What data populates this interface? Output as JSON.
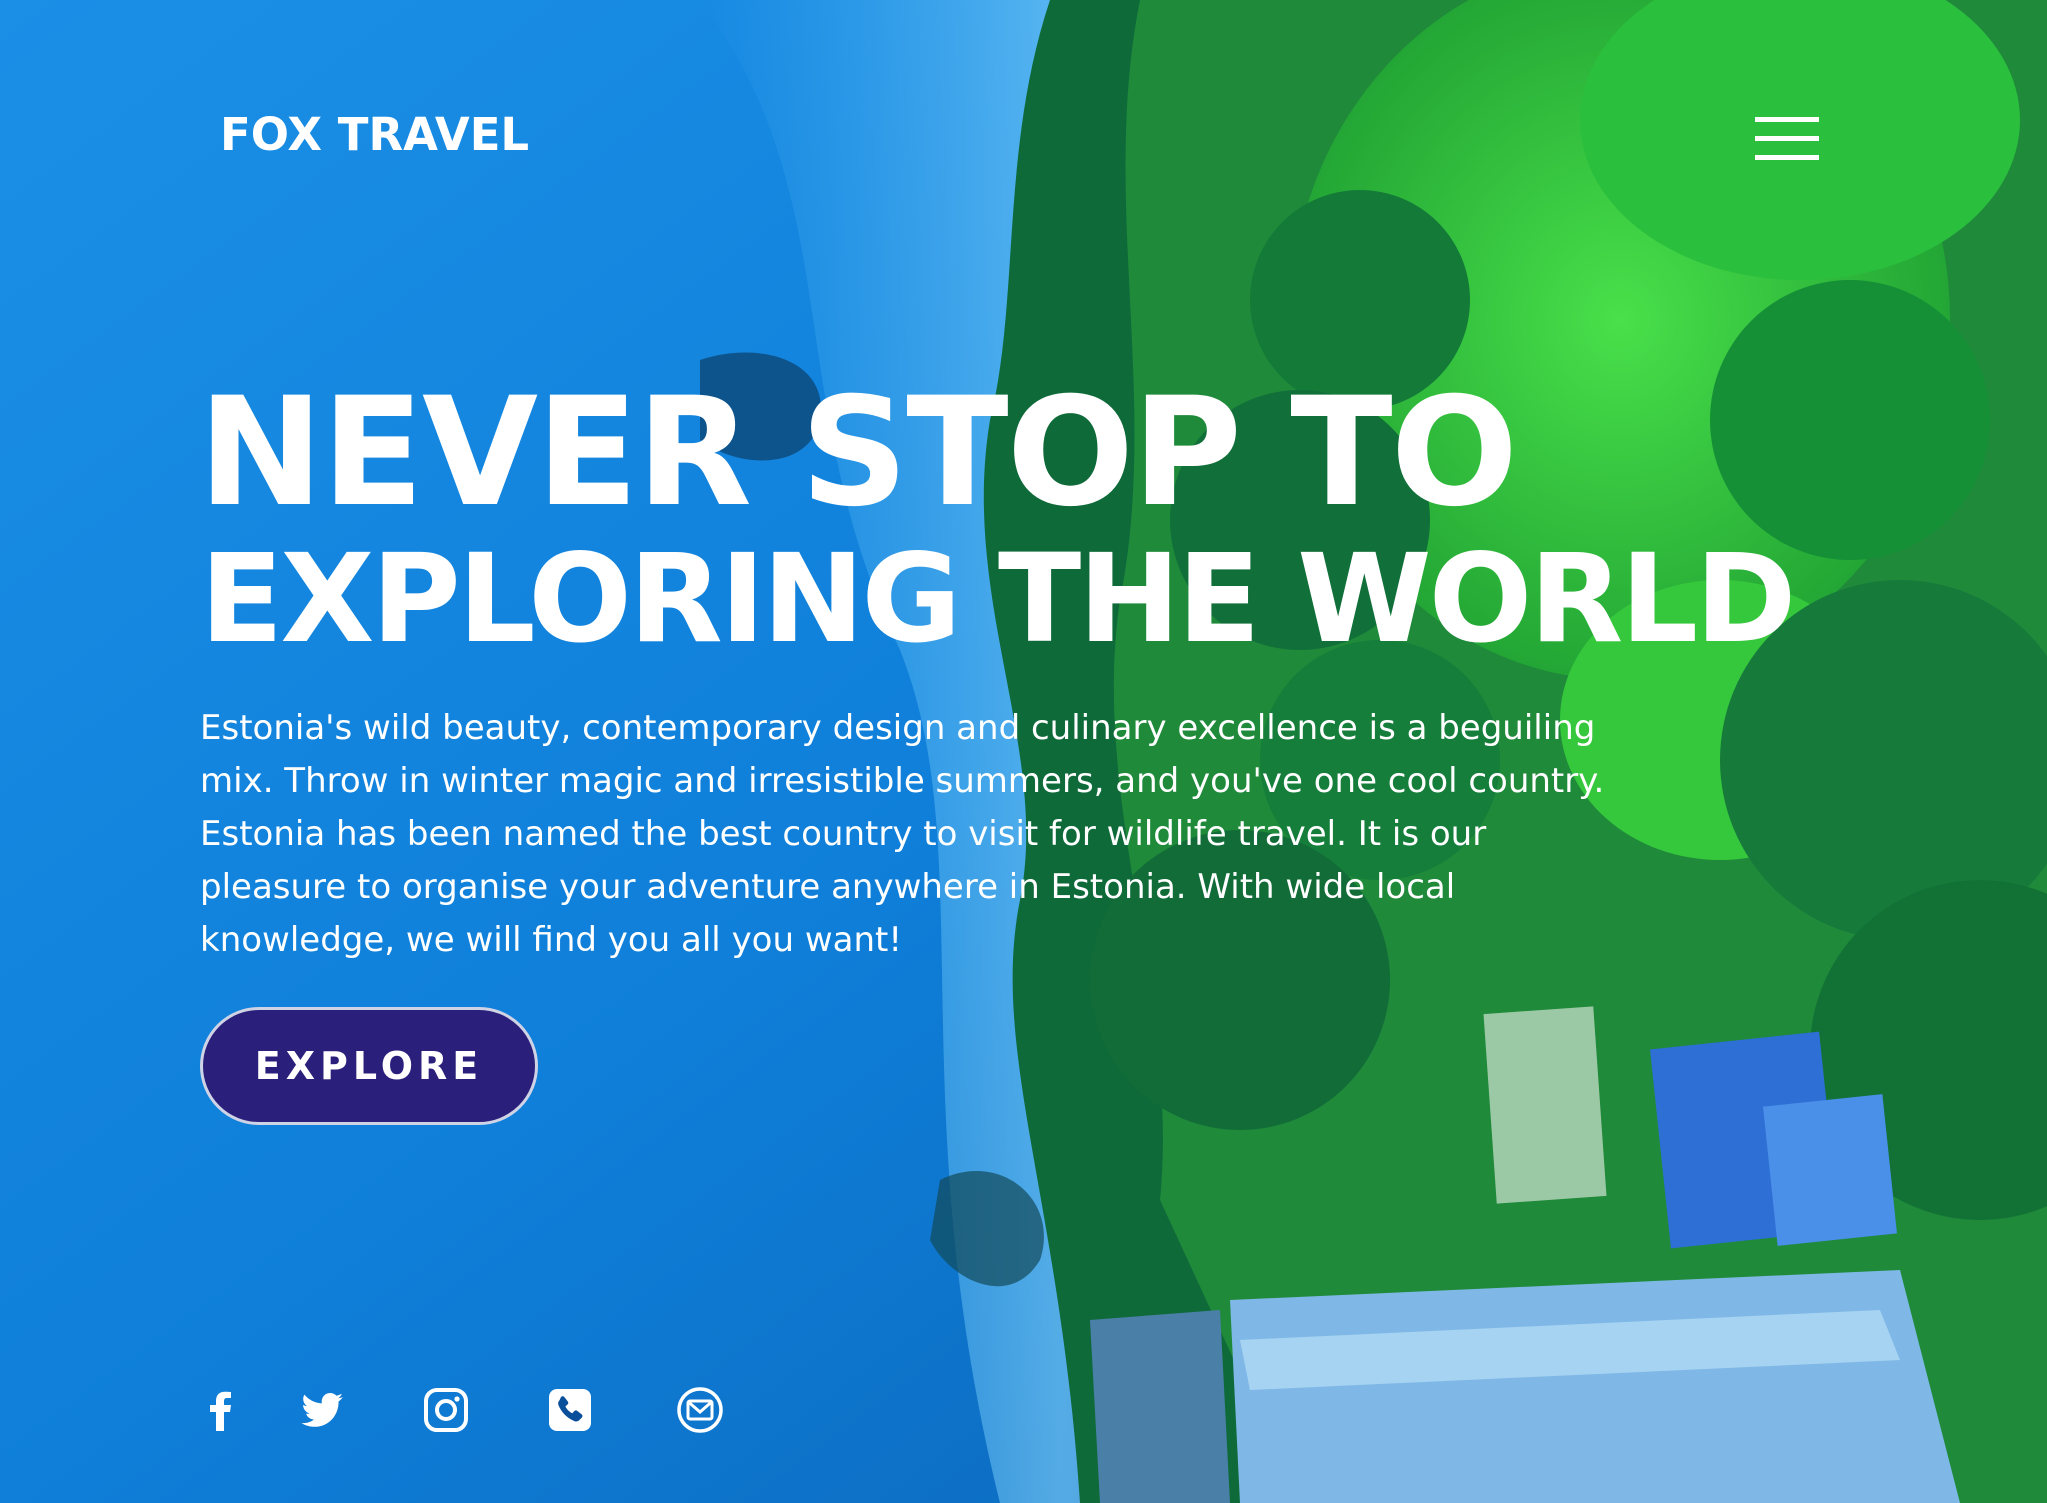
{
  "brand": {
    "name": "FOX TRAVEL"
  },
  "nav": {
    "menu_icon": "hamburger-menu-icon"
  },
  "hero": {
    "headline_line1": "NEVER STOP TO",
    "headline_line2": "EXPLORING THE WORLD",
    "intro": "Estonia's wild beauty, contemporary design and culinary excellence is a beguiling mix. Throw in winter magic and irresistible summers, and you've one cool country. Estonia has been named the best country to visit for wildlife travel. It is our pleasure to organise your adventure anywhere in Estonia. With wide local knowledge, we will find you all you want!",
    "cta_label": "EXPLORE"
  },
  "social": [
    {
      "icon": "facebook-icon"
    },
    {
      "icon": "twitter-icon"
    },
    {
      "icon": "instagram-icon"
    },
    {
      "icon": "phone-icon"
    },
    {
      "icon": "email-icon"
    }
  ],
  "colors": {
    "cta_background": "#2a1f7a",
    "text": "#ffffff",
    "sea": "#1a7fd8",
    "foliage": "#1f8a3a",
    "meadow": "#3fcf3a"
  }
}
